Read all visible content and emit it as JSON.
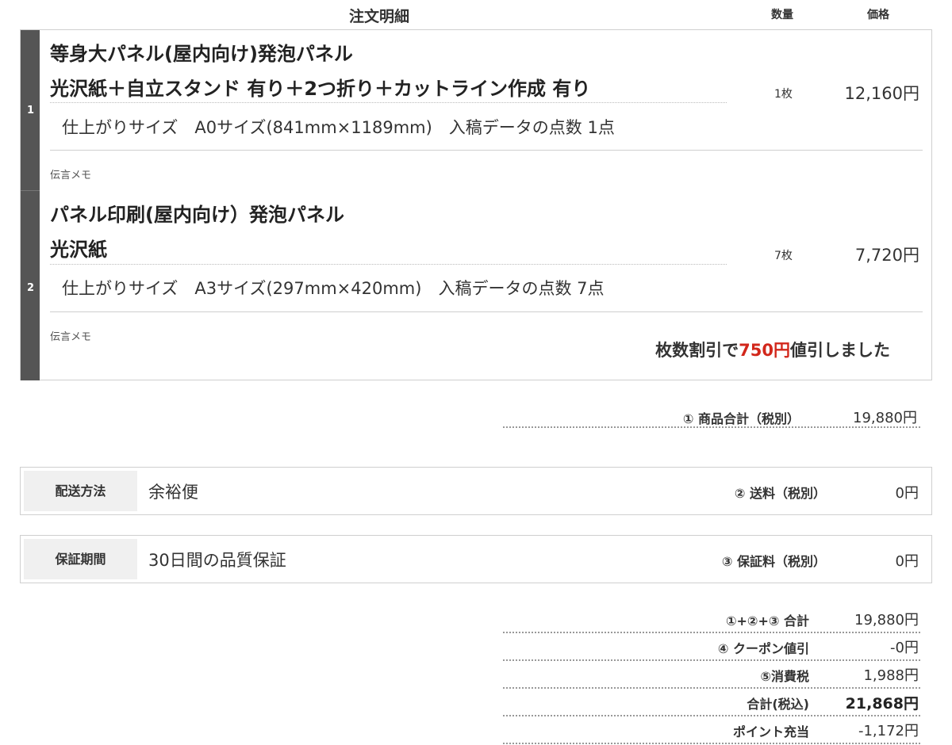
{
  "header": {
    "title": "注文明細",
    "qty_label": "数量",
    "price_label": "価格"
  },
  "items": [
    {
      "number": "1",
      "line1": "等身大パネル(屋内向け)発泡パネル",
      "line2": "光沢紙＋自立スタンド 有り＋2つ折り＋カットライン作成 有り",
      "details": "仕上がりサイズ　A0サイズ(841mm×1189mm)　入稿データの点数  1点",
      "memo_label": "伝言メモ",
      "qty": "1枚",
      "price": "12,160円"
    },
    {
      "number": "2",
      "line1": "パネル印刷(屋内向け）発泡パネル",
      "line2": "光沢紙",
      "details": "仕上がりサイズ　A3サイズ(297mm×420mm)　入稿データの点数  7点",
      "memo_label": "伝言メモ",
      "qty": "7枚",
      "price": "7,720円"
    }
  ],
  "discount_notice": {
    "prefix": "枚数割引で",
    "amount": "750円",
    "suffix": "値引しました",
    "amount_color": "#d2271b"
  },
  "subtotal": {
    "label": "① 商品合計（税別）",
    "value": "19,880円"
  },
  "shipping": {
    "tag": "配送方法",
    "value": "余裕便",
    "fee_label": "② 送料（税別）",
    "fee_value": "0円"
  },
  "warranty": {
    "tag": "保証期間",
    "value": "30日間の品質保証",
    "fee_label": "③ 保証料（税別）",
    "fee_value": "0円"
  },
  "totals": [
    {
      "label": "①+②+③ 合計",
      "value": "19,880円"
    },
    {
      "label": "④ クーポン値引",
      "value": "-0円"
    },
    {
      "label": "⑤消費税",
      "value": "1,988円"
    },
    {
      "label": "合計(税込)",
      "value": "21,868円"
    },
    {
      "label": "ポイント充当",
      "value": "-1,172円"
    }
  ]
}
